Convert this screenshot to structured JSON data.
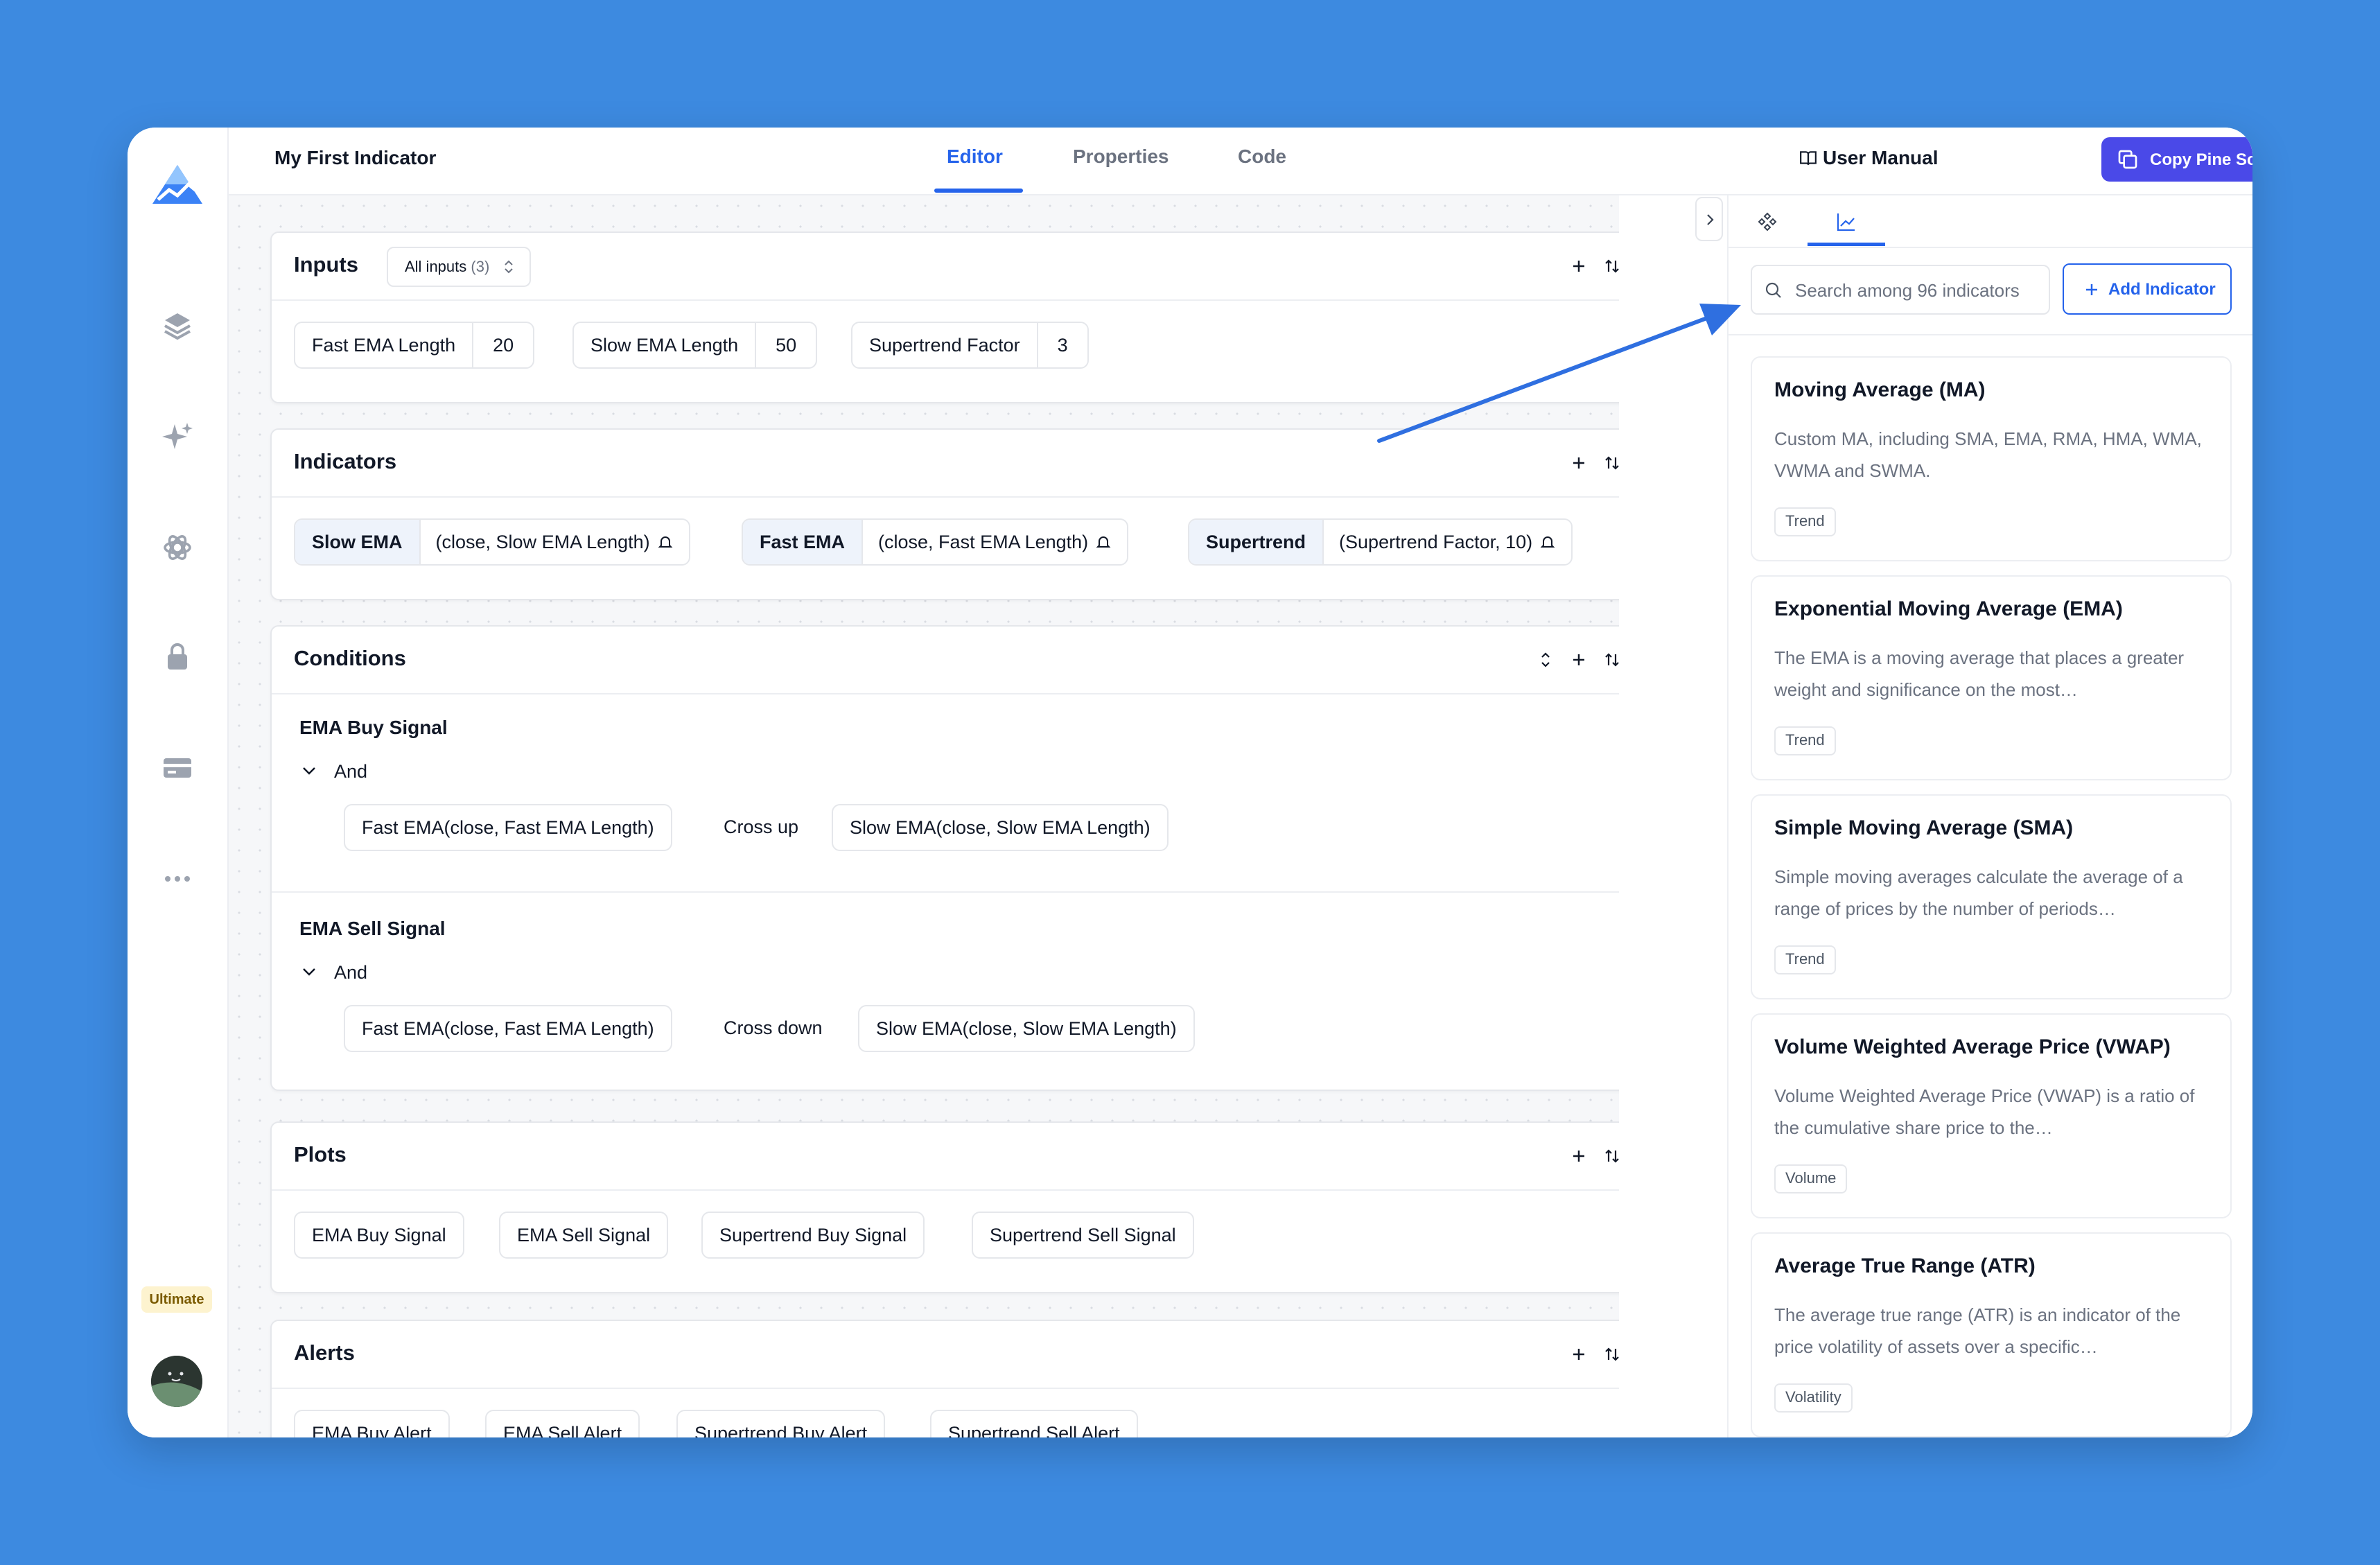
{
  "app": {
    "document_title": "My First Indicator",
    "tabs": [
      {
        "label": "Editor",
        "active": true
      },
      {
        "label": "Properties",
        "active": false
      },
      {
        "label": "Code",
        "active": false
      }
    ],
    "user_manual_label": "User Manual",
    "copy_button_label": "Copy Pine Script",
    "plan_badge": "Ultimate",
    "accent_color": "#2563eb",
    "primary_button_color": "#4a49e8"
  },
  "sidebar": {
    "icons": [
      "logo-icon",
      "layers-icon",
      "sparkles-icon",
      "openai-icon",
      "lock-icon",
      "credit-card-icon",
      "more-horizontal-icon"
    ]
  },
  "inputs": {
    "title": "Inputs",
    "filter": {
      "label": "All inputs",
      "count": "(3)"
    },
    "items": [
      {
        "name": "Fast EMA Length",
        "value": "20"
      },
      {
        "name": "Slow EMA Length",
        "value": "50"
      },
      {
        "name": "Supertrend Factor",
        "value": "3"
      }
    ]
  },
  "indicators": {
    "title": "Indicators",
    "items": [
      {
        "name": "Slow EMA",
        "args": "(close, Slow EMA Length)"
      },
      {
        "name": "Fast EMA",
        "args": "(close, Fast EMA Length)"
      },
      {
        "name": "Supertrend",
        "args": "(Supertrend Factor, 10)"
      }
    ]
  },
  "conditions": {
    "title": "Conditions",
    "items": [
      {
        "name": "EMA Buy Signal",
        "logic": "And",
        "left": "Fast EMA(close, Fast EMA Length)",
        "operator": "Cross up",
        "right": "Slow EMA(close, Slow EMA Length)"
      },
      {
        "name": "EMA Sell Signal",
        "logic": "And",
        "left": "Fast EMA(close, Fast EMA Length)",
        "operator": "Cross down",
        "right": "Slow EMA(close, Slow EMA Length)"
      }
    ]
  },
  "plots": {
    "title": "Plots",
    "items": [
      "EMA Buy Signal",
      "EMA Sell Signal",
      "Supertrend Buy Signal",
      "Supertrend Sell Signal"
    ]
  },
  "alerts": {
    "title": "Alerts",
    "items": [
      "EMA Buy Alert",
      "EMA Sell Alert",
      "Supertrend Buy Alert",
      "Supertrend Sell Alert"
    ]
  },
  "panel": {
    "search_placeholder": "Search among 96 indicators",
    "add_indicator_label": "Add Indicator",
    "indicators": [
      {
        "title": "Moving Average (MA)",
        "desc": "Custom MA, including SMA, EMA, RMA, HMA, WMA, VWMA and SWMA.",
        "tag": "Trend"
      },
      {
        "title": "Exponential Moving Average (EMA)",
        "desc": "The EMA is a moving average that places a greater weight and significance on the most…",
        "tag": "Trend"
      },
      {
        "title": "Simple Moving Average (SMA)",
        "desc": "Simple moving averages calculate the average of a range of prices by the number of periods…",
        "tag": "Trend"
      },
      {
        "title": "Volume Weighted Average Price (VWAP)",
        "desc": "Volume Weighted Average Price (VWAP) is a ratio of the cumulative share price to the…",
        "tag": "Volume"
      },
      {
        "title": "Average True Range (ATR)",
        "desc": "The average true range (ATR) is an indicator of the price volatility of assets over a specific…",
        "tag": "Volatility"
      }
    ]
  }
}
